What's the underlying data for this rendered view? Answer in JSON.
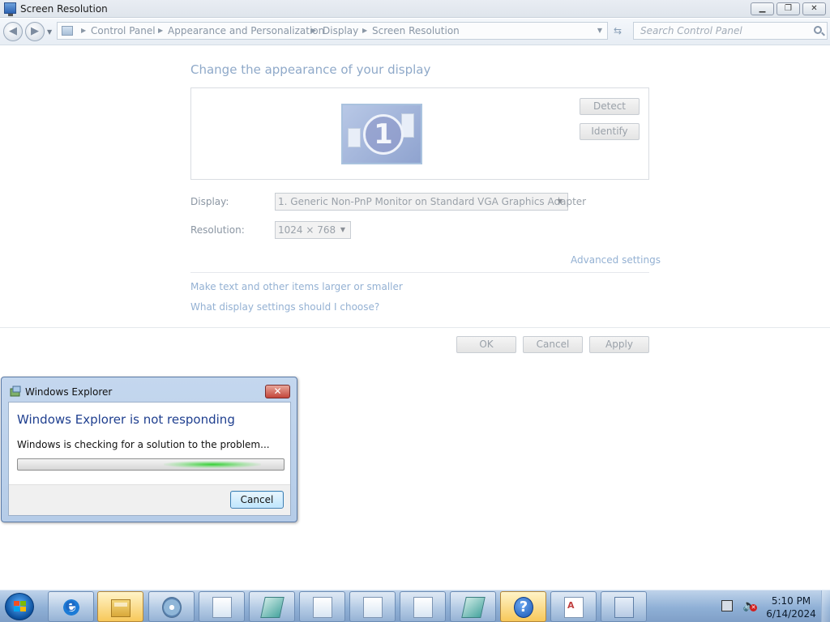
{
  "window": {
    "title": "Screen Resolution",
    "minimize": "▁",
    "restore": "❐",
    "close": "✕"
  },
  "addressbar": {
    "back": "◀",
    "forward": "▶",
    "breadcrumbs": [
      "Control Panel",
      "Appearance and Personalization",
      "Display",
      "Screen Resolution"
    ],
    "separator": "▶",
    "search_placeholder": "Search Control Panel"
  },
  "content": {
    "heading": "Change the appearance of your display",
    "monitor_number": "1",
    "detect_label": "Detect",
    "identify_label": "Identify",
    "display_label": "Display:",
    "display_value": "1. Generic Non-PnP Monitor on Standard VGA Graphics Adapter",
    "resolution_label": "Resolution:",
    "resolution_value": "1024 × 768",
    "advanced_link": "Advanced settings",
    "link_text_size": "Make text and other items larger or smaller",
    "link_help": "What display settings should I choose?",
    "ok_label": "OK",
    "cancel_label": "Cancel",
    "apply_label": "Apply"
  },
  "dialog": {
    "title": "Windows Explorer",
    "close": "✕",
    "heading": "Windows Explorer is not responding",
    "message": "Windows is checking for a solution to the problem...",
    "cancel_label": "Cancel"
  },
  "taskbar": {
    "help_glyph": "?",
    "time": "5:10 PM",
    "date": "6/14/2024"
  }
}
